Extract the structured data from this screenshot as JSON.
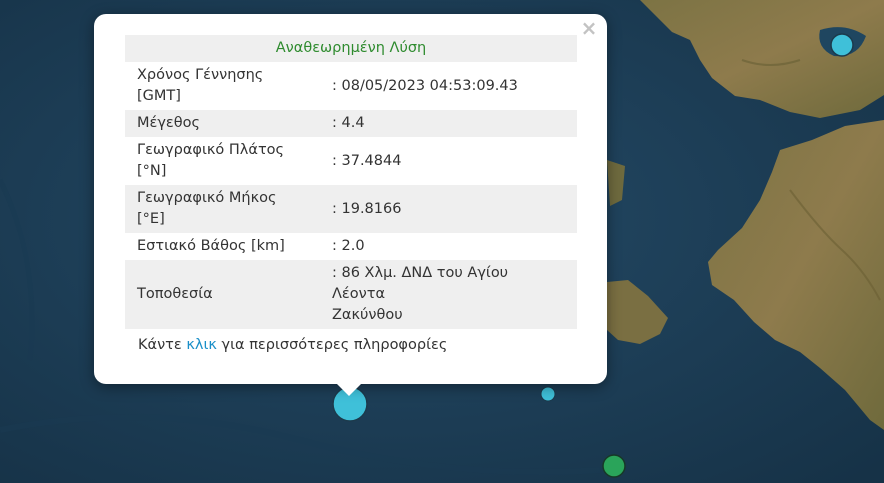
{
  "popup": {
    "close_glyph": "×",
    "header": "Αναθεωρημένη Λύση",
    "rows": [
      {
        "label_line1": "Χρόνος Γέννησης",
        "label_line2": "[GMT]",
        "value": ": 08/05/2023 04:53:09.43"
      },
      {
        "label_line1": "Μέγεθος",
        "label_line2": "",
        "value": ": 4.4"
      },
      {
        "label_line1": "Γεωγραφικό Πλάτος",
        "label_line2": "[°N]",
        "value": ": 37.4844"
      },
      {
        "label_line1": "Γεωγραφικό Μήκος",
        "label_line2": "[°E]",
        "value": ": 19.8166"
      },
      {
        "label_line1": "Εστιακό Βάθος [km]",
        "label_line2": "",
        "value": ": 2.0"
      },
      {
        "label_line1": "Τοποθεσία",
        "label_line2": "",
        "value_line1": ": 86 Χλμ. ΔΝΔ του Αγίου Λέοντα",
        "value_line2": "Ζακύνθου"
      }
    ],
    "footer_before": "Κάντε ",
    "footer_link": "κλικ",
    "footer_after": " για περισσότερες πληροφορίες"
  },
  "colors": {
    "sea": "#1d3f58",
    "land": "#8a7a48",
    "marker_cyan": "#3fc0d9",
    "marker_green": "#2aa45a",
    "header_green": "#2e8b2e",
    "link_blue": "#1a8fc8"
  },
  "markers": [
    {
      "name": "selected-earthquake-marker",
      "color": "cyan"
    },
    {
      "name": "earthquake-marker-small",
      "color": "cyan"
    },
    {
      "name": "earthquake-marker-north",
      "color": "cyan"
    },
    {
      "name": "earthquake-marker-green",
      "color": "green"
    }
  ]
}
